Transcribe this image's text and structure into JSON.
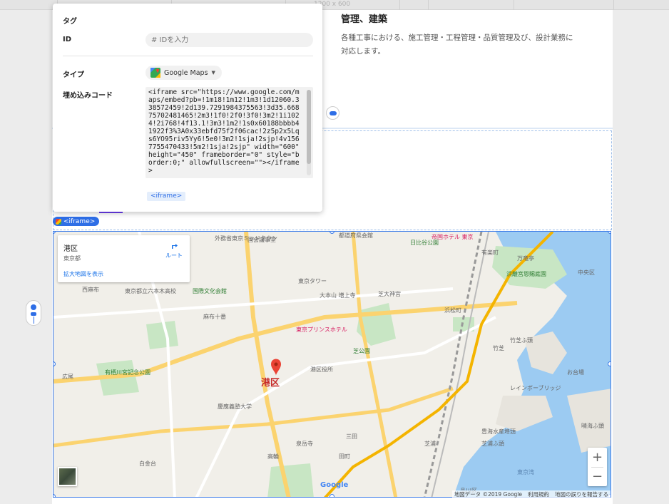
{
  "ruler": {
    "size_label": "1200 x 600"
  },
  "section": {
    "title": "管理、建築",
    "body": "各種工事における、施工管理・工程管理・品質管理及び、設計業務に対応します。"
  },
  "panel": {
    "tag_label": "タグ",
    "id_label": "ID",
    "id_placeholder": "# IDを入力",
    "type_label": "タイプ",
    "type_value": "Google Maps",
    "embed_label": "埋め込みコード",
    "embed_code": "<iframe src=\"https://www.google.com/maps/embed?pb=!1m18!1m12!1m3!1d12060.338572459!2d139.7291984375563!3d35.66875702481465!2m3!1f0!2f0!3f0!3m2!1i1024!2i768!4f13.1!3m3!1m2!1s0x60188bbbb41922f3%3A0x33ebfd75f2f06cac!2z5p2x5Lqs6YO95riv5Yy6!5e0!3m2!1sja!2sjp!4v1567755470433!5m2!1sja!2sjp\" width=\"600\" height=\"450\" frameborder=\"0\" style=\"border:0;\" allowfullscreen=\"\"></iframe>",
    "chip_label": "<iframe>"
  },
  "element_tag": "<iframe>",
  "map": {
    "place_name": "港区",
    "place_addr": "東京都",
    "route_label": "ルート",
    "enlarge_link": "拡大地図を表示",
    "district_label": "港区",
    "zoom_in": "+",
    "zoom_out": "−",
    "google_logo": "Google",
    "footer_data": "地図データ ©2019 Google",
    "footer_terms": "利用規約",
    "footer_report": "地図の誤りを報告する",
    "labels": [
      "外務省",
      "国会議事堂",
      "都道府県会館",
      "日比谷公園",
      "帝国ホテル 東京",
      "有楽町",
      "万竜亭",
      "浜離宮恩賜庭園",
      "中央区",
      "西麻布",
      "東京都立六本木高校",
      "国際文化会館",
      "東京タワー",
      "大本山 増上寺",
      "芝大神宮",
      "浜松町",
      "竹芝ふ頭",
      "麻布十番",
      "広尾",
      "有栖川宮記念公園",
      "東京ミッドタウン",
      "三田",
      "田町",
      "品川区",
      "高輪",
      "白金台",
      "芝浦",
      "豊海水産埠頭",
      "東京湾",
      "竹芝",
      "港区役所",
      "東京プリンスホテル",
      "芝公園",
      "芝浦ふ頭",
      "慶應義塾大学",
      "泉岳寺",
      "レインボーブリッジ",
      "お台場",
      "晴海ふ頭"
    ]
  },
  "colors": {
    "accent": "#2e6ee6",
    "selection": "#3b7be8",
    "map_land": "#f1efe9",
    "map_water": "#9ccbf2",
    "map_park": "#c8e6c4",
    "map_major_road": "#fbd36f",
    "district_red": "#c62828"
  }
}
